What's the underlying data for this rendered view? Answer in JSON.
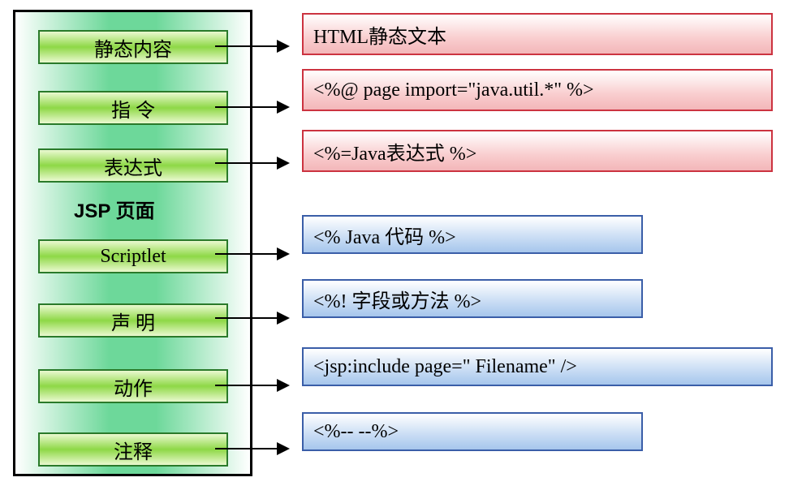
{
  "container_title": "JSP 页面",
  "left": {
    "static_content": "静态内容",
    "directive": "指 令",
    "expression": "表达式",
    "scriptlet": "Scriptlet",
    "declaration": "声 明",
    "action": "动作",
    "comment": "注释"
  },
  "right": {
    "static_content": "HTML静态文本",
    "directive": "<%@ page import=\"java.util.*\" %>",
    "expression": "<%=Java表达式 %>",
    "scriptlet": "<% Java 代码 %>",
    "declaration": "<%! 字段或方法 %>",
    "action": "<jsp:include page=\" Filename\" />",
    "comment": "<%-- --%>"
  }
}
